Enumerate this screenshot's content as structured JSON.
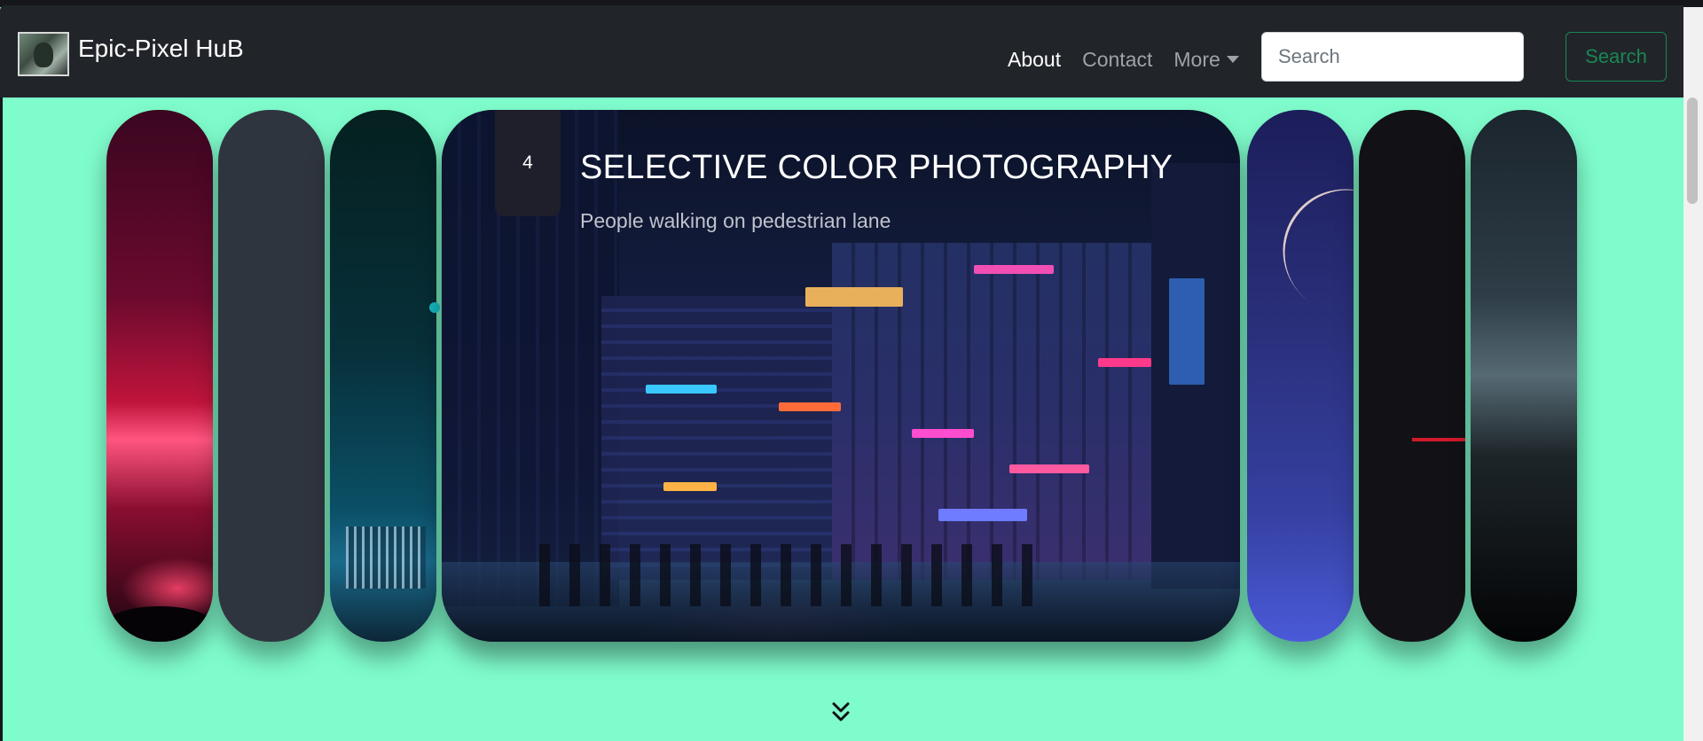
{
  "navbar": {
    "brand": {
      "name": "Epic-Pixel HuB",
      "logo_icon": "avatar-logo-icon"
    },
    "links": [
      {
        "label": "About",
        "active": true
      },
      {
        "label": "Contact",
        "active": false
      },
      {
        "label": "More",
        "active": false,
        "dropdown": true
      }
    ],
    "search": {
      "placeholder": "Search",
      "value": "",
      "button_label": "Search"
    }
  },
  "carousel": {
    "active_slide": {
      "number": "4",
      "title": "SELECTIVE COLOR PHOTOGRAPHY",
      "subtitle": "People walking on pedestrian lane"
    },
    "scroll_icon": "double-chevron-down-icon"
  },
  "colors": {
    "page_background": "#7ffccc",
    "navbar_background": "#212529",
    "search_button": "#198754"
  }
}
